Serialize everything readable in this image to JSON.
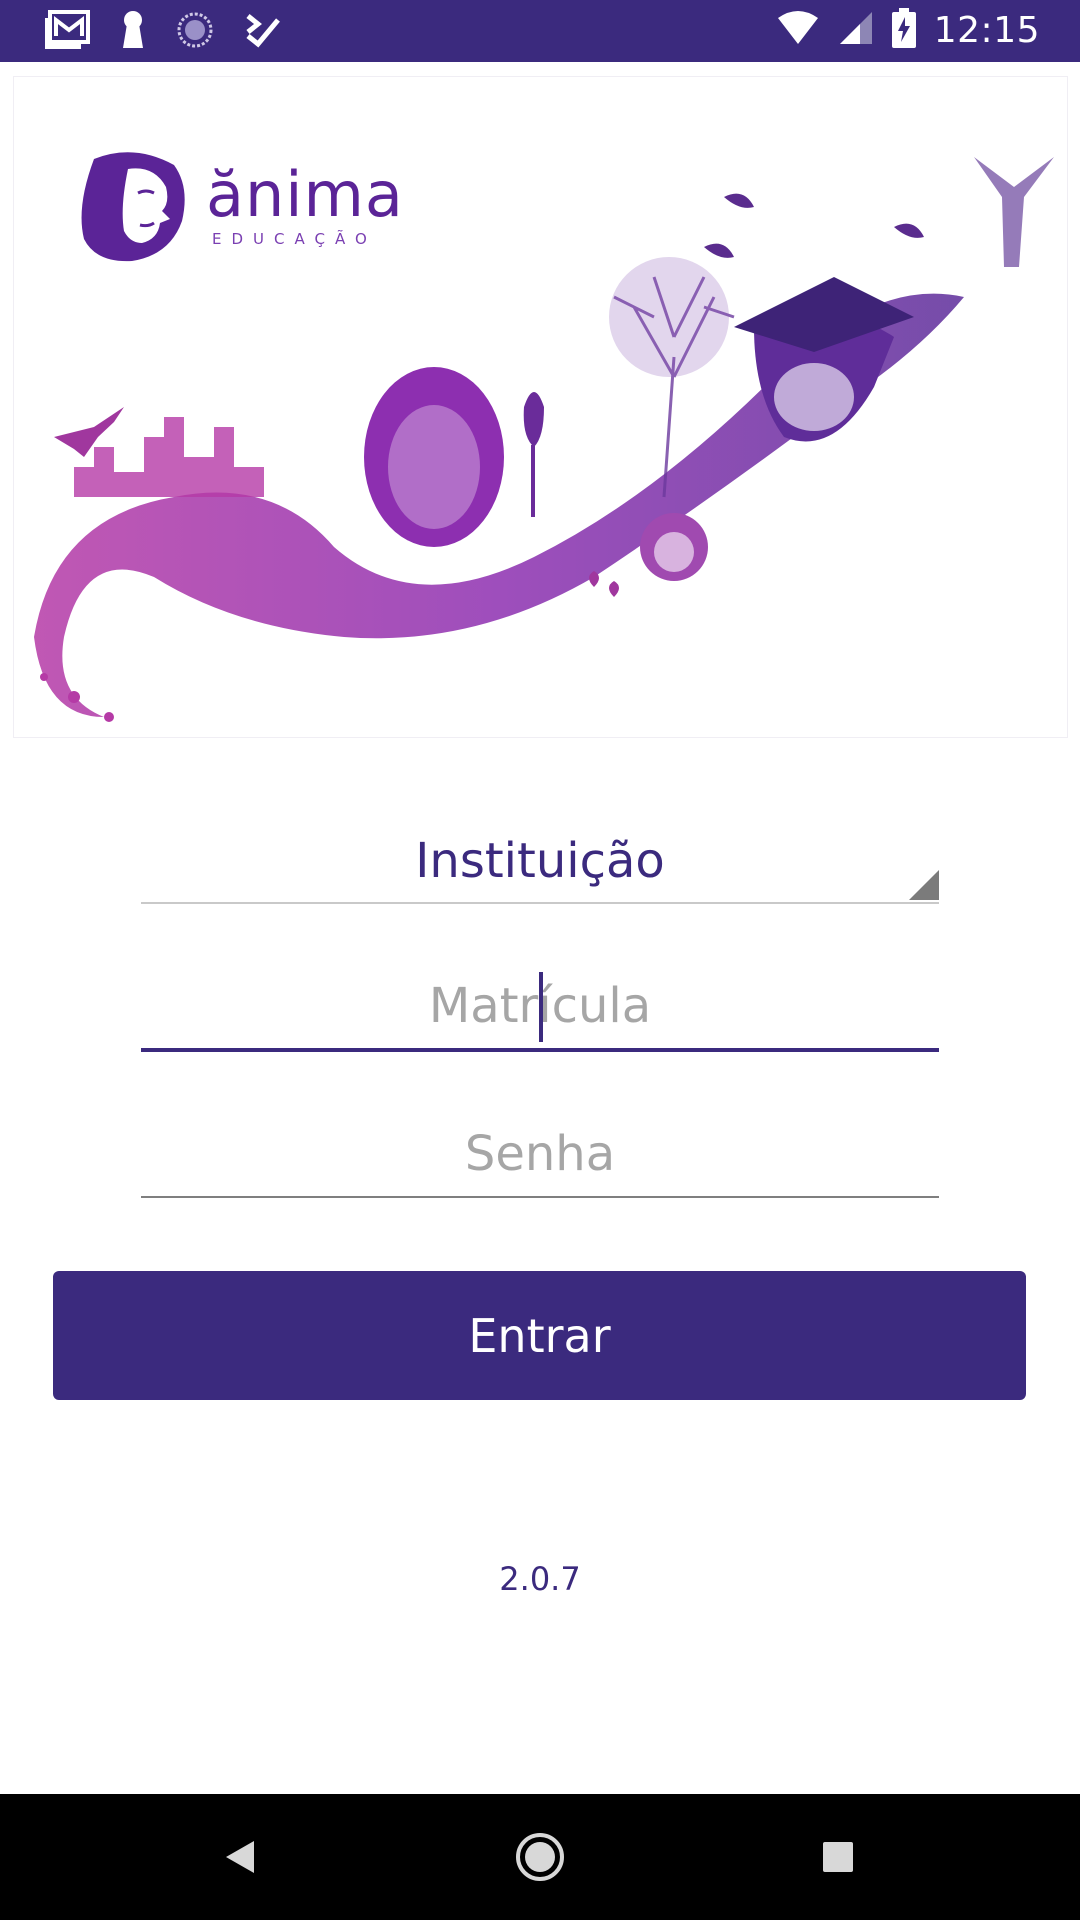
{
  "status_bar": {
    "time": "12:15",
    "icons": [
      "gallery-icon",
      "keyhole-icon",
      "sync-icon",
      "check-list-icon",
      "wifi-icon",
      "signal-icon",
      "battery-charging-icon"
    ]
  },
  "banner": {
    "logo_name": "ănima",
    "logo_sub": "EDUCAÇÃO"
  },
  "form": {
    "institution_label": "Instituição",
    "matricula_placeholder": "Matrícula",
    "senha_placeholder": "Senha"
  },
  "actions": {
    "login_label": "Entrar"
  },
  "footer": {
    "version": "2.0.7"
  },
  "colors": {
    "primary": "#3b2a7e",
    "brand_purple": "#5b2497",
    "nav_bar": "#000000"
  }
}
